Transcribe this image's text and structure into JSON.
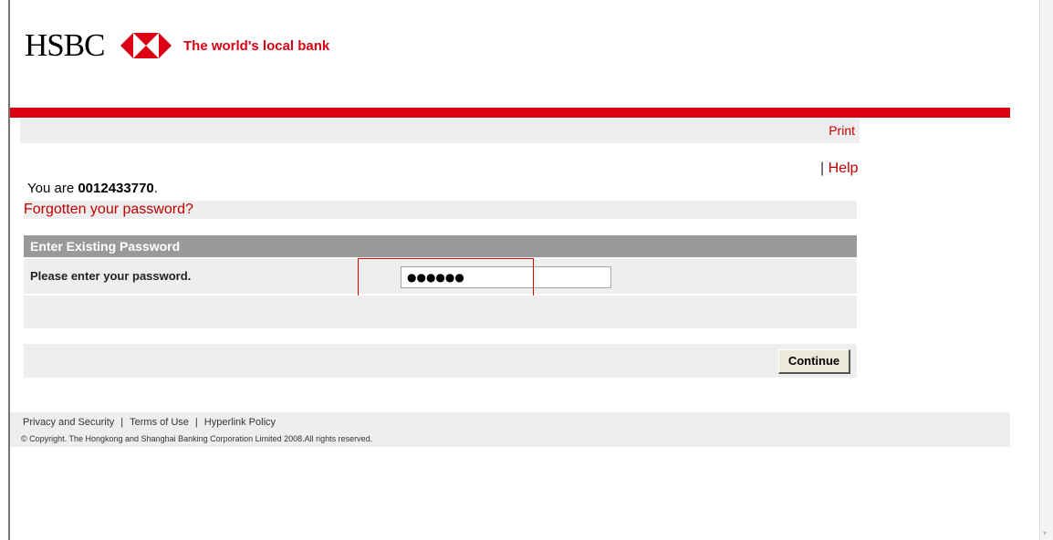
{
  "header": {
    "brand": "HSBC",
    "tagline": "The world's local bank",
    "brand_color": "#db0011"
  },
  "toolbar": {
    "print_label": "Print",
    "help_separator": "|",
    "help_label": "Help"
  },
  "user": {
    "prefix": "You are ",
    "user_id": "0012433770",
    "suffix": "."
  },
  "forgot_password_label": "Forgotten your password?",
  "password_section": {
    "title": "Enter Existing Password",
    "label": "Please enter your password.",
    "masked_value": "●●●●●●"
  },
  "continue_label": "Continue",
  "footer": {
    "links": [
      "Privacy and Security",
      "Terms of Use",
      "Hyperlink Policy"
    ],
    "separator": "|",
    "copyright": "© Copyright. The Hongkong and Shanghai Banking Corporation Limited 2008.All rights reserved."
  },
  "icons": {
    "logo": "hsbc-hexagon-logo-icon",
    "scroll": "scroll-down-arrow-icon"
  }
}
